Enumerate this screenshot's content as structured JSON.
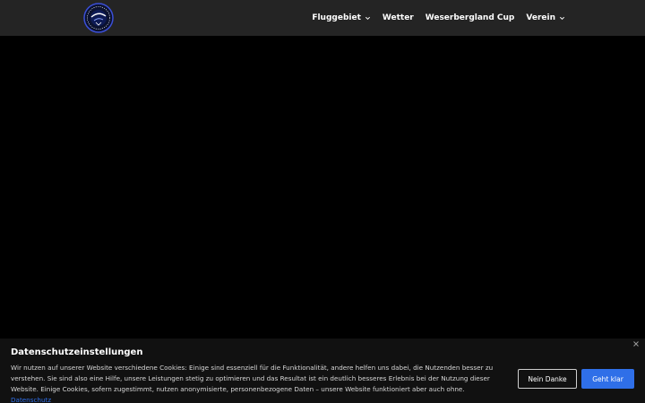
{
  "header": {
    "logo": {
      "icon": "club-emblem-icon"
    },
    "nav": [
      {
        "label": "Fluggebiet",
        "has_dropdown": true
      },
      {
        "label": "Wetter",
        "has_dropdown": false
      },
      {
        "label": "Weserbergland Cup",
        "has_dropdown": false
      },
      {
        "label": "Verein",
        "has_dropdown": true
      }
    ]
  },
  "cookie_banner": {
    "title": "Datenschutzeinstellungen",
    "text": "Wir nutzen auf unserer Website verschiedene Cookies: Einige sind essenziell für die Funktionalität, andere helfen uns dabei, die Nutzenden besser zu verstehen. Sie sind also eine Hilfe, unsere Leistungen stetig zu optimieren und das Resultat ist ein deutlich besseres Erlebnis bei der Nutzung dieser Website. Einige Cookies, sofern zugestimmt, nutzen anonymisierte, personenbezogene Daten – unsere Website funktioniert aber auch ohne.",
    "link_label": "Datenschutz",
    "decline_label": "Nein Danke",
    "accept_label": "Geht klar",
    "close_icon": "close-icon"
  },
  "colors": {
    "header_bg": "#242424",
    "page_bg": "#000000",
    "banner_bg": "#111111",
    "accent": "#2f6fe8"
  }
}
